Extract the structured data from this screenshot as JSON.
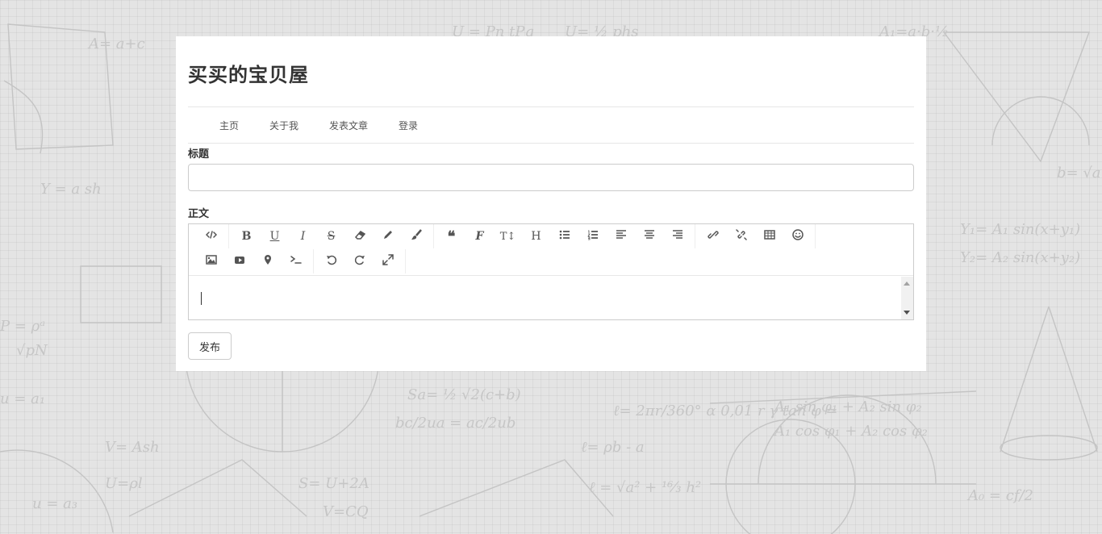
{
  "site": {
    "title": "买买的宝贝屋"
  },
  "nav": {
    "items": [
      "主页",
      "关于我",
      "发表文章",
      "登录"
    ]
  },
  "form": {
    "title_label": "标题",
    "title_value": "",
    "body_label": "正文",
    "submit_label": "发布"
  },
  "toolbar": {
    "row1": [
      [
        "code-view-icon"
      ],
      [
        "bold-icon",
        "underline-icon",
        "italic-icon",
        "strikethrough-icon",
        "eraser-icon",
        "pencil-icon",
        "paint-brush-icon"
      ],
      [
        "quote-icon",
        "font-icon",
        "text-height-icon",
        "header-icon",
        "unordered-list-icon",
        "ordered-list-icon",
        "align-left-icon",
        "align-center-icon",
        "align-right-icon"
      ],
      [
        "link-icon",
        "unlink-icon",
        "table-icon",
        "emoji-icon"
      ]
    ],
    "row2": [
      [
        "image-icon",
        "video-icon",
        "map-marker-icon",
        "terminal-icon"
      ],
      [
        "undo-icon",
        "redo-icon",
        "fullscreen-icon"
      ]
    ],
    "glyphs": {
      "bold-icon": "B",
      "underline-icon": "U",
      "italic-icon": "I",
      "strikethrough-icon": "S",
      "quote-icon": "❝",
      "font-icon": "F",
      "text-height-icon": "T↕",
      "header-icon": "H"
    }
  },
  "colors": {
    "page_bg": "#e4e4e4",
    "card_bg": "#ffffff",
    "icon": "#555555",
    "border": "#cccccc"
  }
}
